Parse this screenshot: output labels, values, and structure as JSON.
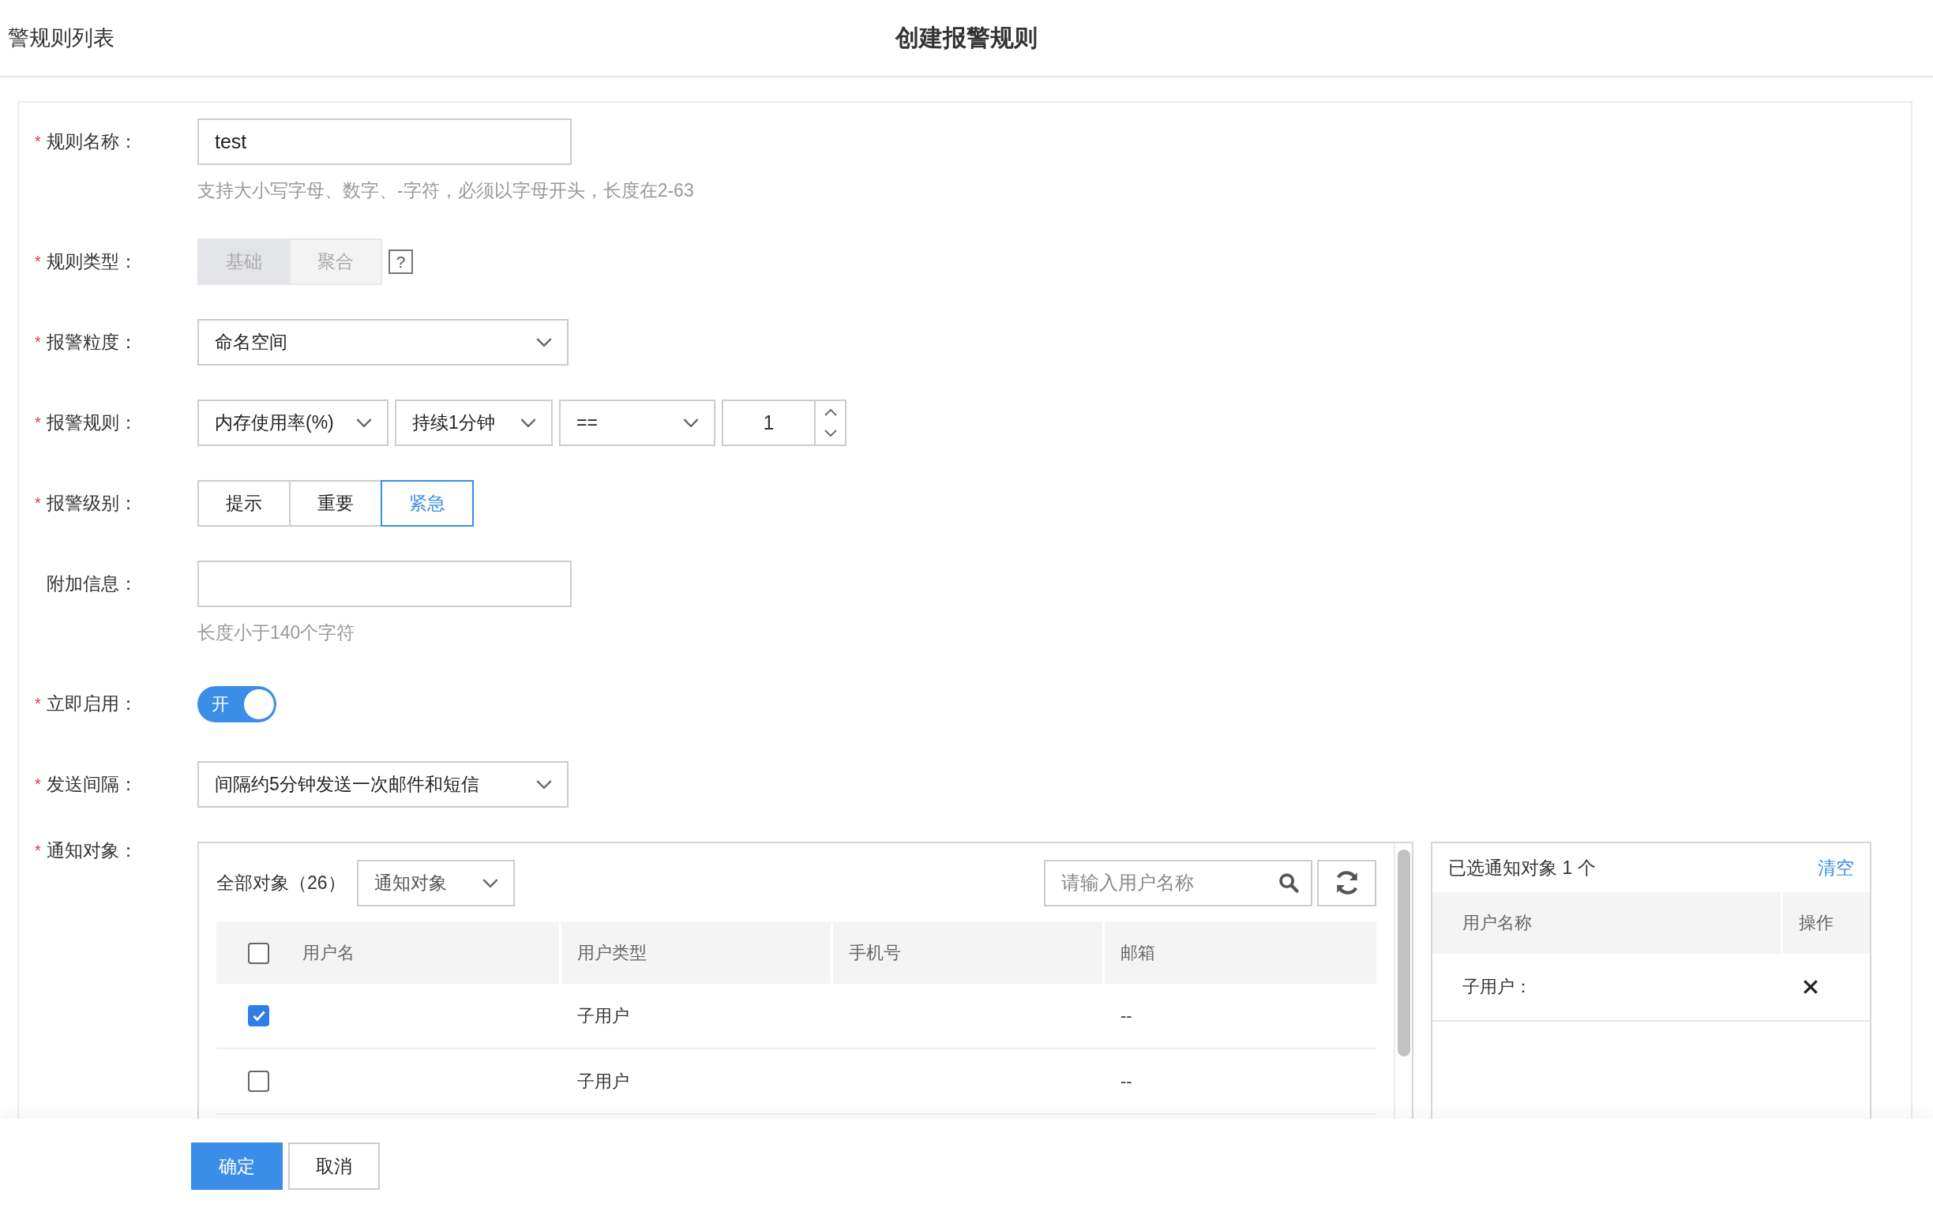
{
  "header": {
    "back_link": "警规则列表",
    "title": "创建报警规则"
  },
  "fields": [
    {
      "kind": "text",
      "label": "规则名称：",
      "required_mark": "*",
      "value": "test",
      "hint": "支持大小写字母、数字、-字符，必须以字母开头，长度在2-63"
    },
    {
      "kind": "segmented",
      "label": "规则类型：",
      "required_mark": "*",
      "disabled": true,
      "help": "?",
      "options": [
        {
          "label": "基础",
          "selected": true
        },
        {
          "label": "聚合",
          "selected": false
        }
      ]
    },
    {
      "kind": "select",
      "label": "报警粒度：",
      "required_mark": "*",
      "value": "命名空间"
    },
    {
      "kind": "rule",
      "label": "报警规则：",
      "required_mark": "*",
      "metric": "内存使用率(%)",
      "duration": "持续1分钟",
      "operator": "==",
      "threshold": "1"
    },
    {
      "kind": "segmented",
      "label": "报警级别：",
      "required_mark": "*",
      "disabled": false,
      "options": [
        {
          "label": "提示",
          "selected": false
        },
        {
          "label": "重要",
          "selected": false
        },
        {
          "label": "紧急",
          "selected": true
        }
      ]
    },
    {
      "kind": "text",
      "label": "附加信息：",
      "hint": "长度小于140个字符"
    },
    {
      "kind": "switch",
      "label": "立即启用：",
      "required_mark": "*",
      "on": true,
      "text": "开"
    },
    {
      "kind": "select",
      "label": "发送间隔：",
      "required_mark": "*",
      "value": "间隔约5分钟发送一次邮件和短信"
    },
    {
      "kind": "recipients",
      "label": "通知对象：",
      "required_mark": "*"
    }
  ],
  "recipients": {
    "all_label": "全部对象（26）",
    "filter": "通知对象",
    "search_placeholder": "请输入用户名称",
    "select_all_checked": false,
    "columns": [
      "用户名",
      "用户类型",
      "手机号",
      "邮箱"
    ],
    "rows": [
      {
        "checked": true,
        "user_type": "子用户",
        "email": "--"
      },
      {
        "checked": false,
        "user_type": "子用户",
        "email": "--"
      }
    ],
    "selected_panel": {
      "title": "已选通知对象 1 个",
      "clear": "清空",
      "columns": [
        "用户名称",
        "操作"
      ],
      "rows": [
        {
          "name": "子用户："
        }
      ]
    }
  },
  "buttons": [
    {
      "label": "确定",
      "kind": "primary"
    },
    {
      "label": "取消",
      "kind": "default"
    }
  ]
}
